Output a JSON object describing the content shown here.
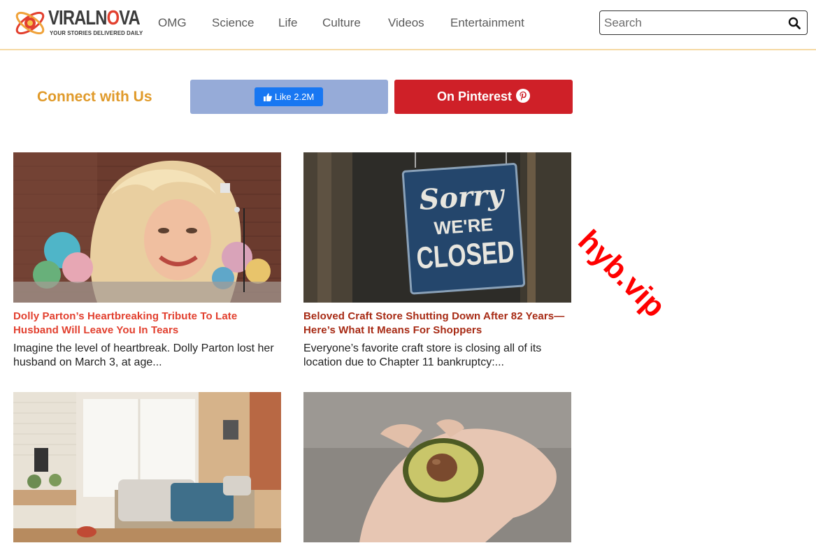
{
  "header": {
    "logo": {
      "name_pre": "VIRALN",
      "name_o": "O",
      "name_post": "VA",
      "tagline": "YOUR STORIES DELIVERED DAILY"
    },
    "nav": [
      "OMG",
      "Science",
      "Life",
      "Culture",
      "Videos",
      "Entertainment"
    ],
    "search": {
      "placeholder": "Search",
      "value": "",
      "icon": "search-icon"
    }
  },
  "connect": {
    "label": "Connect with Us",
    "facebook_label": "Like 2.2M",
    "pinterest_label": "On Pinterest"
  },
  "articles": [
    {
      "title": "Dolly Parton’s Heartbreaking Tribute To Late Husband Will Leave You In Tears",
      "excerpt": "Imagine the level of heartbreak. Dolly Parton lost her husband on March 3, at age..."
    },
    {
      "title": "Beloved Craft Store Shutting Down After 82 Years—Here’s What It Means For Shoppers",
      "excerpt": "Everyone’s favorite craft store is closing all of its location due to Chapter 11 bankruptcy:...",
      "sign_line1": "Sorry",
      "sign_line2": "WE'RE",
      "sign_line3": "CLOSED"
    },
    {
      "title": "",
      "excerpt": ""
    },
    {
      "title": "",
      "excerpt": ""
    }
  ],
  "watermark": "hyb.vip",
  "colors": {
    "accent_orange": "#e09a2a",
    "title_red": "#e2402f",
    "title_dark_red": "#a72a14",
    "facebook_blue": "#1877f2",
    "pinterest_red": "#cf2028"
  }
}
